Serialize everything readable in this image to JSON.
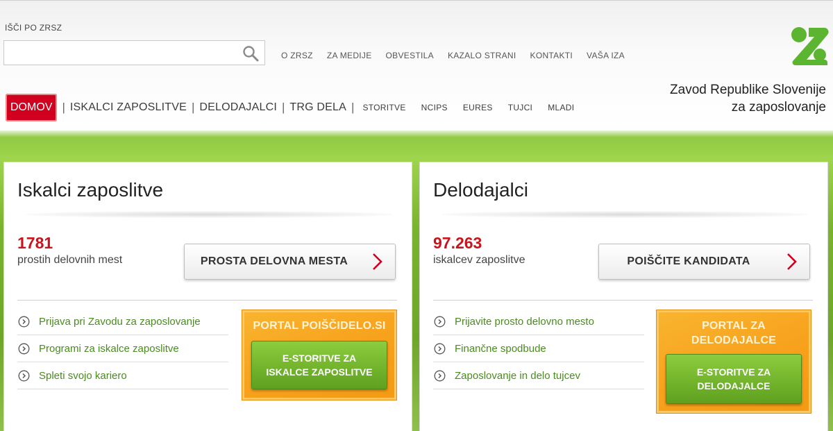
{
  "header": {
    "search_label": "IŠČI PO ZRSZ",
    "search_value": "",
    "top_links": [
      "O ZRSZ",
      "ZA MEDIJE",
      "OBVESTILA",
      "KAZALO STRANI",
      "KONTAKTI",
      "VAŠA IZA"
    ],
    "org_name_line1": "Zavod Republike Slovenije",
    "org_name_line2": "za zaposlovanje",
    "logo_color": "#5cb531"
  },
  "nav": {
    "home": "DOMOV",
    "main": [
      "ISKALCI ZAPOSLITVE",
      "DELODAJALCI",
      "TRG DELA"
    ],
    "secondary": [
      "STORITVE",
      "NCIPS",
      "EURES",
      "TUJCI",
      "MLADI"
    ]
  },
  "panels": {
    "left": {
      "title": "Iskalci zaposlitve",
      "stat_number": "1781",
      "stat_label": "prostih delovnih mest",
      "cta": "PROSTA DELOVNA MESTA",
      "links": [
        "Prijava pri Zavodu za zaposlovanje",
        "Programi za iskalce zaposlitve",
        "Spleti svojo kariero"
      ],
      "promo_title": "PORTAL POIŠČIDELO.SI",
      "promo_button_line1": "E-STORITVE ZA",
      "promo_button_line2": "ISKALCE ZAPOSLITVE"
    },
    "right": {
      "title": "Delodajalci",
      "stat_number": "97.263",
      "stat_label": "iskalcev zaposlitve",
      "cta": "POIŠČITE KANDIDATA",
      "links": [
        "Prijavite prosto delovno mesto",
        "Finančne spodbude",
        "Zaposlovanje in delo tujcev"
      ],
      "promo_title_line1": "PORTAL ZA",
      "promo_title_line2": "DELODAJALCE",
      "promo_button_line1": "E-STORITVE ZA",
      "promo_button_line2": "DELODAJALCE"
    }
  },
  "colors": {
    "accent_red": "#d2001f",
    "stat_red": "#c4161c",
    "link_green": "#4a8b1f",
    "promo_orange": "#f7a11c"
  }
}
